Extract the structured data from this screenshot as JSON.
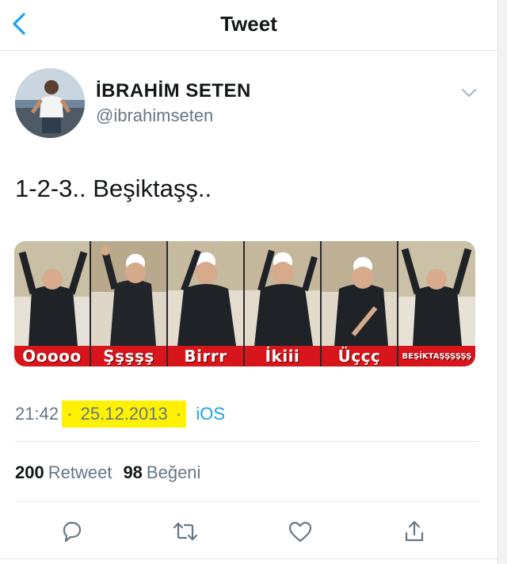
{
  "header": {
    "title": "Tweet",
    "back_icon": "chevron-left-icon",
    "accent": "#1da1f2"
  },
  "author": {
    "display_name": "İBRAHİM SETEN",
    "handle": "@ibrahimseten"
  },
  "tweet": {
    "text": "1-2-3.. Beşiktaşş..",
    "media_captions": [
      "Ooooo",
      "Şşşşş",
      "Birrr",
      "İkiii",
      "Üççç",
      "BEŞİKTAŞŞŞŞŞŞ"
    ],
    "time": "21:42",
    "separator": "·",
    "date": "25.12.2013",
    "source": "iOS"
  },
  "stats": {
    "retweets_count": "200",
    "retweets_label": "Retweet",
    "likes_count": "98",
    "likes_label": "Beğeni"
  },
  "actions": [
    "reply-icon",
    "retweet-icon",
    "like-icon",
    "share-icon"
  ],
  "colors": {
    "secondary_text": "#657786",
    "date_highlight": "#fff200",
    "caption_bar": "#d8151a"
  }
}
